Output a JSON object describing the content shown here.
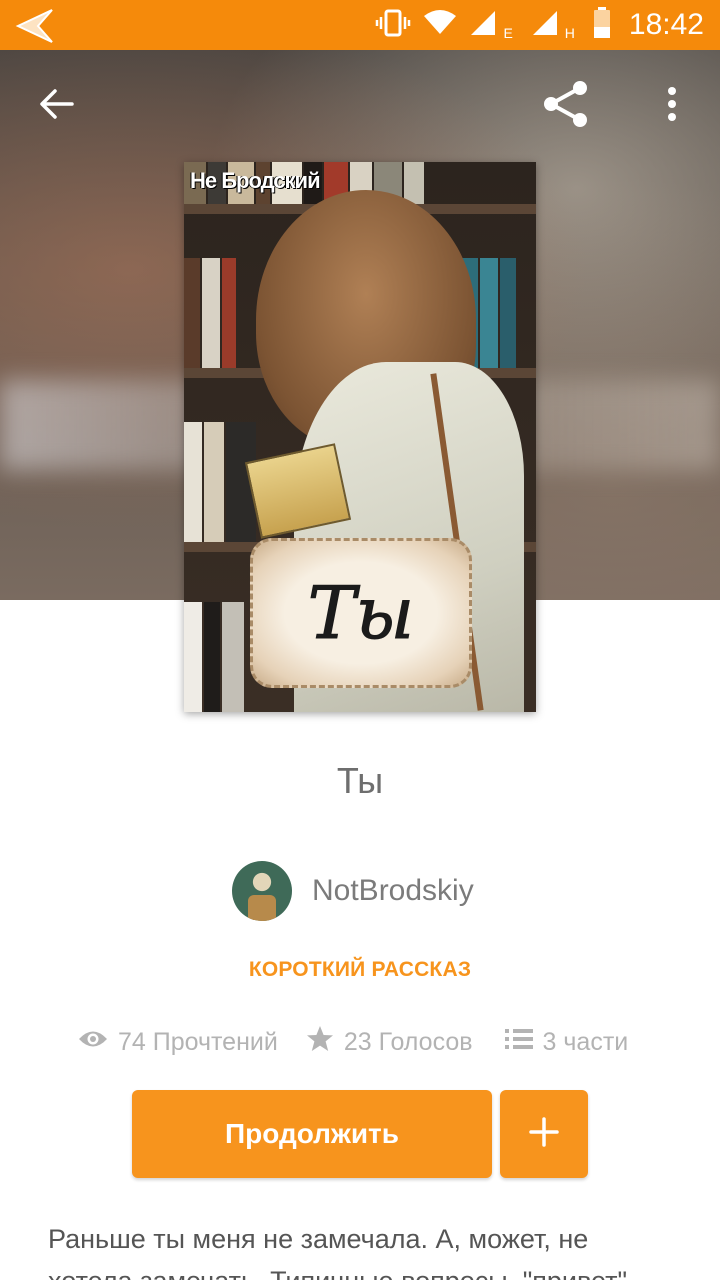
{
  "status_bar": {
    "time": "18:42",
    "network_1": "E",
    "network_2": "H",
    "icons": [
      "back-icon",
      "vibrate-icon",
      "wifi-icon",
      "signal-icon",
      "signal-icon",
      "battery-icon"
    ]
  },
  "toolbar": {
    "icons": [
      "arrow-left-icon",
      "share-icon",
      "more-vert-icon"
    ]
  },
  "cover": {
    "author_text": "Не Бродский",
    "title_text": "Ты"
  },
  "story": {
    "title": "Ты",
    "author": "NotBrodskiy",
    "genre": "КОРОТКИЙ РАССКАЗ",
    "reads": "74 Прочтений",
    "votes": "23 Голосов",
    "parts": "3 части",
    "description": "Раньше ты меня не замечала. А, может, не хотела замечать. Типичные вопросы, \"привет\","
  },
  "actions": {
    "continue_label": "Продолжить",
    "add_label": "+"
  },
  "colors": {
    "accent": "#f7941d",
    "status_bar": "#f58a0b",
    "muted_text": "#b3b3b3"
  }
}
